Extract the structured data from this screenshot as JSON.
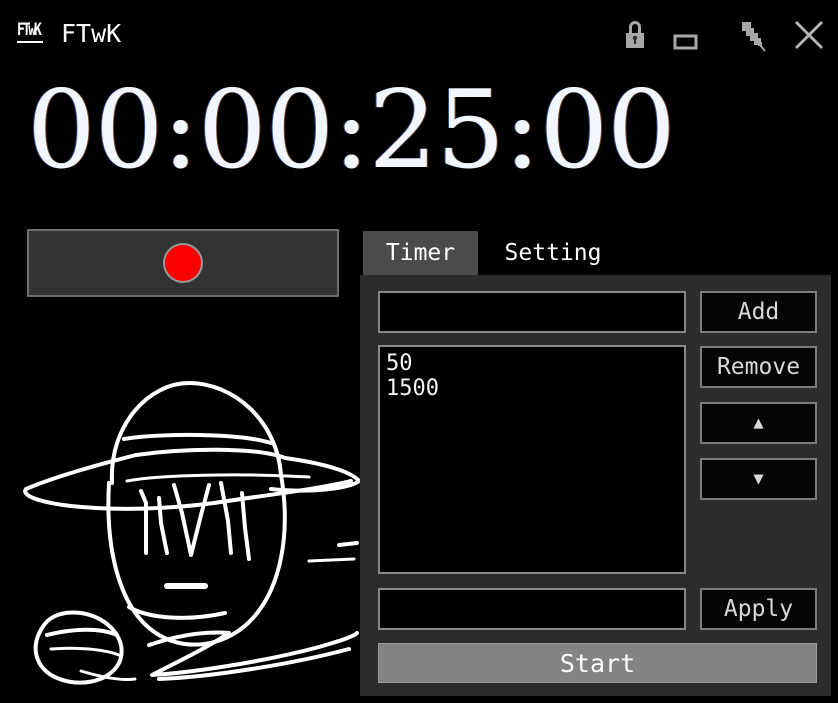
{
  "window": {
    "app_icon_label": "FTwK",
    "title": "FTwK",
    "controls": {
      "lock_label": "lock-icon",
      "minimize_label": "minimize-icon",
      "pin_label": "pin-icon",
      "close_label": "close-icon"
    }
  },
  "timer": {
    "display": "00:00:25:00"
  },
  "status": {
    "indicator_color": "#fa0000",
    "indicator_label": "recording-indicator"
  },
  "artwork": {
    "label": "hand-drawn-face-with-hat",
    "stroke_color": "#ffffff"
  },
  "tabs": [
    {
      "id": "timer",
      "label": "Timer",
      "active": true
    },
    {
      "id": "setting",
      "label": "Setting",
      "active": false
    }
  ],
  "panel": {
    "add_input": {
      "value": "",
      "placeholder": ""
    },
    "apply_input": {
      "value": "",
      "placeholder": ""
    },
    "list_items": [
      "50",
      "1500"
    ],
    "buttons": {
      "add": "Add",
      "remove": "Remove",
      "move_up": "▲",
      "move_down": "▼",
      "apply": "Apply",
      "start": "Start"
    }
  },
  "colors": {
    "window_background": "#000000",
    "panel_background": "#2c2c2c",
    "tab_active_background": "#4b4b4b",
    "field_background": "#000000",
    "field_border": "#8a8a8a",
    "start_button": "#838383",
    "text": "#ffffff"
  }
}
